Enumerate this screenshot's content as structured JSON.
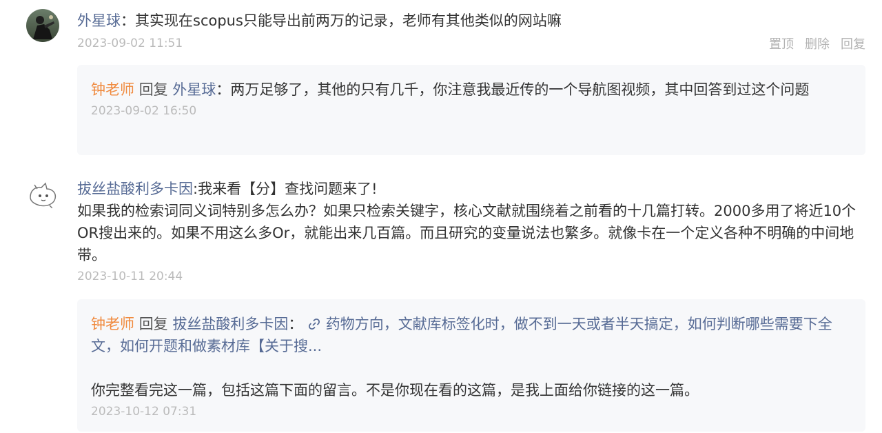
{
  "comments": [
    {
      "nickname": "外星球",
      "separator": "：",
      "text": "其实现在scopus只能导出前两万的记录，老师有其他类似的网站嘛",
      "time": "2023-09-02 11:51",
      "actions": [
        "置顶",
        "删除",
        "回复"
      ],
      "reply": {
        "author": "钟老师",
        "verb": "回复",
        "target": "外星球",
        "separator": "：",
        "text": "两万足够了，其他的只有几千，你注意我最近传的一个导航图视频，其中回答到过这个问题",
        "time": "2023-09-02 16:50"
      }
    },
    {
      "nickname": "拔丝盐酸利多卡因",
      "separator": ":",
      "text_line1": "我来看【分】查找问题来了!",
      "text_rest": "如果我的检索词同义词特别多怎么办？如果只检索关键字，核心文献就围绕着之前看的十几篇打转。2000多用了将近10个OR搜出来的。如果不用这么多Or，就能出来几百篇。而且研究的变量说法也繁多。就像卡在一个定义各种不明确的中间地带。",
      "time": "2023-10-11 20:44",
      "reply": {
        "author": "钟老师",
        "verb": "回复",
        "target": "拔丝盐酸利多卡因",
        "separator": "：",
        "link_icon": "link-icon",
        "link_text": "药物方向，文献库标签化时，做不到一天或者半天搞定，如何判断哪些需要下全文，如何开题和做素材库【关于搜...",
        "text": "你完整看完这一篇，包括这篇下面的留言。不是你现在看的这篇，是我上面给你链接的这一篇。",
        "time": "2023-10-12 07:31"
      }
    }
  ],
  "colors": {
    "nickname": "#576b95",
    "author": "#f08a3e",
    "time": "#bbbbbb",
    "reply_bg": "#f7f8fa"
  }
}
